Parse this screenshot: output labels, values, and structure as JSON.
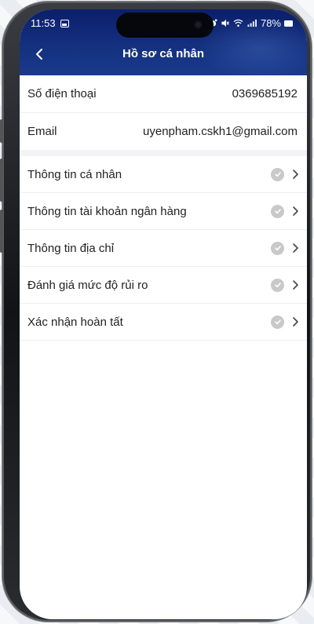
{
  "status_bar": {
    "time": "11:53",
    "battery": "78%"
  },
  "header": {
    "title": "Hồ sơ cá nhân",
    "back_icon": "chevron-left-icon"
  },
  "contact": [
    {
      "label": "Số điện thoại",
      "value": "0369685192"
    },
    {
      "label": "Email",
      "value": "uyenpham.cskh1@gmail.com"
    }
  ],
  "menu": [
    {
      "label": "Thông tin cá nhân",
      "status_icon": "check-circle-icon"
    },
    {
      "label": "Thông tin tài khoản ngân hàng",
      "status_icon": "check-circle-icon"
    },
    {
      "label": "Thông tin địa chỉ",
      "status_icon": "check-circle-icon"
    },
    {
      "label": "Đánh giá mức độ rủi ro",
      "status_icon": "check-circle-icon"
    },
    {
      "label": "Xác nhận hoàn tất",
      "status_icon": "check-circle-icon"
    }
  ],
  "colors": {
    "header": "#14307f",
    "check": "#c9c9c9",
    "text": "#222222"
  }
}
